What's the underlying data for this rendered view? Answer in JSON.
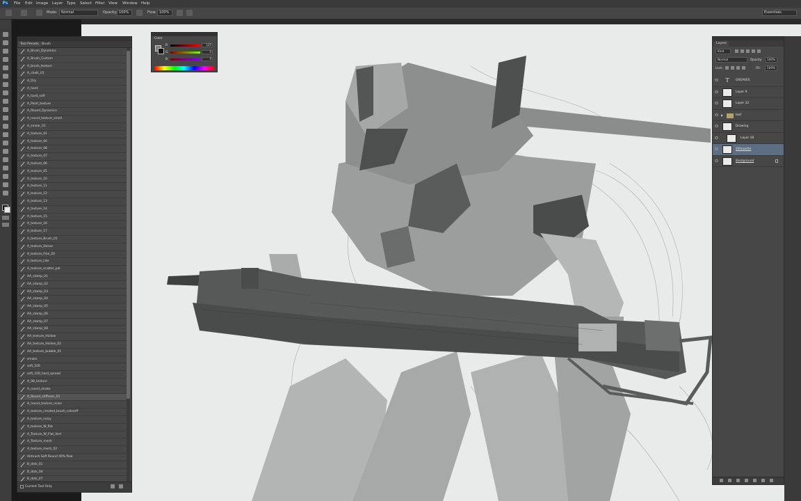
{
  "app": {
    "logo": "Ps"
  },
  "menu": [
    "File",
    "Edit",
    "Image",
    "Layer",
    "Type",
    "Select",
    "Filter",
    "View",
    "Window",
    "Help"
  ],
  "options": {
    "mode_label": "Mode:",
    "mode_value": "Normal",
    "opacity_label": "Opacity:",
    "opacity_value": "100%",
    "flow_label": "Flow:",
    "flow_value": "100%",
    "workspace": "Essentials"
  },
  "tool_presets": {
    "tab_active": "Tool Presets",
    "tab_other": "Brush",
    "items": [
      "A_Brush_Dynamics",
      "A_Brush_Custom",
      "A_brush_texture",
      "A_chalk_01",
      "A_Dry",
      "A_hard",
      "A_hard_soft",
      "A_Paint_texture",
      "A_Round_Dynamics",
      "A_round_texture_small",
      "A_smear_01",
      "A_texture_01",
      "A_texture_04",
      "A_texture_08",
      "A_texture_07",
      "A_texture_06",
      "A_texture_05",
      "A_texture_10",
      "A_texture_11",
      "A_texture_12",
      "A_texture_13",
      "A_texture_14",
      "A_texture_15",
      "A_texture_16",
      "A_texture_17",
      "A_texture_Brush_01",
      "A_texture_Dense",
      "A_texture_Fine_20",
      "A_texture_Lite",
      "A_texture_scatter_pal",
      "AA_stamp_01",
      "AA_stamp_02",
      "AA_stamp_03",
      "AA_stamp_04",
      "AA_stamp_05",
      "AA_stamp_06",
      "AA_stamp_07",
      "AA_stamp_08",
      "AA_texture_Hollow",
      "AA_texture_Hollow_02",
      "AA_texture_bubble_01",
      "smoke",
      "soft_100",
      "soft_100_hard_spread",
      "A_08_texture",
      "A_round_stroke",
      "A_Round_stiffness_01",
      "A_round_texture_noise",
      "A_texture_created_brush_coloroff",
      "A_texture_noisy",
      "A_texture_W_flat",
      "A_Texture_W_Flat_Vert",
      "A_Texture_mesh",
      "A_texture_mesh_02",
      "Airbrush Soft Round 40% flow",
      "B_dots_01",
      "B_dots_04",
      "B_dots_07"
    ],
    "selected_index": 46,
    "footer_label": "Current Tool Only"
  },
  "color_panel": {
    "tab": "Color",
    "channels": [
      {
        "name": "R",
        "value": "125"
      },
      {
        "name": "G",
        "value": "0"
      },
      {
        "name": "B",
        "value": "0"
      }
    ],
    "foreground": "#7d7d7d",
    "background": "#111111"
  },
  "layers_panel": {
    "tab": "Layers",
    "kind_filter": "Kind",
    "blend_mode": "Normal",
    "opacity_label": "Opacity:",
    "opacity_value": "100%",
    "lock_label": "Lock:",
    "fill_label": "Fill:",
    "fill_value": "100%",
    "layers": [
      {
        "name": "GREAVES",
        "type": "text",
        "selected": false
      },
      {
        "name": "Layer 9",
        "type": "pixel",
        "selected": false
      },
      {
        "name": "Layer 12",
        "type": "pixel",
        "selected": false
      },
      {
        "name": "leaf",
        "type": "group",
        "selected": false
      },
      {
        "name": "Drawing",
        "type": "pixel",
        "selected": false
      },
      {
        "name": "Layer 18",
        "type": "pixel",
        "selected": false,
        "indent": true
      },
      {
        "name": "Silhouette",
        "type": "pixel",
        "selected": true
      },
      {
        "name": "Background",
        "type": "pixel",
        "selected": false,
        "locked": true
      }
    ]
  },
  "colors": {
    "app_bg": "#2b2b2b",
    "panel": "#474747",
    "canvas": "#e9ebea",
    "mecha_light": "#a7a9a8",
    "mecha_mid": "#8b8d8c",
    "mecha_dark": "#4a4c4b",
    "gun": "#575958",
    "selection": "#5d6e84"
  }
}
